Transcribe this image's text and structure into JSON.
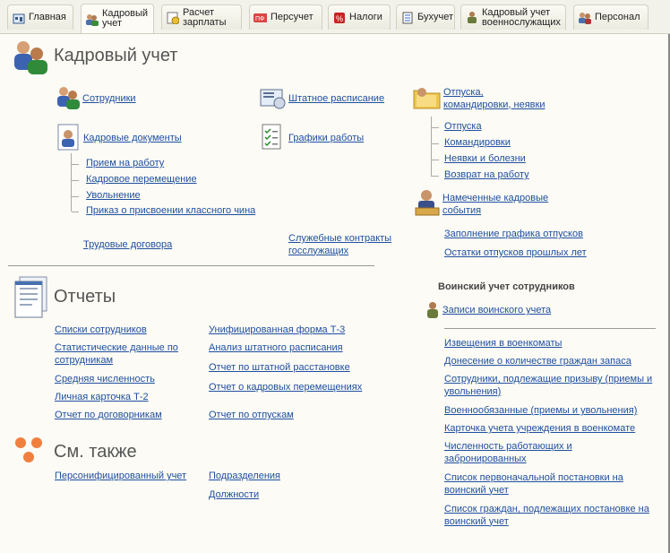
{
  "tabs": [
    {
      "label": "Главная",
      "icon": "home-icon"
    },
    {
      "label": "Кадровый\nучет",
      "icon": "people-icon"
    },
    {
      "label": "Расчет\nзарплаты",
      "icon": "payroll-icon"
    },
    {
      "label": "Персучет",
      "icon": "pfr-icon"
    },
    {
      "label": "Налоги",
      "icon": "taxes-icon"
    },
    {
      "label": "Бухучет",
      "icon": "accounting-icon"
    },
    {
      "label": "Кадровый учет\nвоеннослужащих",
      "icon": "military-icon"
    },
    {
      "label": "Персонал",
      "icon": "personnel-icon"
    }
  ],
  "hr_section": {
    "title": "Кадровый учет",
    "employees": "Сотрудники",
    "staff_schedule": "Штатное расписание",
    "leave_group": "Отпуска,\nкомандировки, неявки",
    "hr_docs": "Кадровые документы",
    "work_schedules": "Графики работы",
    "doc_items": [
      "Прием на работу",
      "Кадровое перемещение",
      "Увольнение",
      "Приказ о присвоении классного чина"
    ],
    "leave_items": [
      "Отпуска",
      "Командировки",
      "Неявки и болезни",
      "Возврат на работу"
    ],
    "planned_events": "Намеченные кадровые\nсобытия",
    "leave_plan": "Заполнение графика отпусков",
    "leave_balances": "Остатки отпусков прошлых лет",
    "labor_contracts": "Трудовые договора",
    "service_contracts": "Служебные контракты\nгосслужащих"
  },
  "reports": {
    "title": "Отчеты",
    "col1": [
      "Списки сотрудников",
      "Статистические данные по\nсотрудникам",
      "Средняя численность",
      "Личная карточка Т-2",
      "Отчет по договорникам"
    ],
    "col2": [
      "Унифицированная форма Т-3",
      "Анализ штатного расписания",
      "Отчет по штатной расстановке",
      "Отчет о кадровых перемещениях",
      "Отчет по отпускам"
    ]
  },
  "military": {
    "title": "Воинский учет сотрудников",
    "records": "Записи воинского учета",
    "items": [
      "Извещения в военкоматы",
      "Донесение о количестве граждан запаса",
      "Сотрудники, подлежащие призыву (приемы и\nувольнения)",
      "Военнообязанные (приемы и увольнения)",
      "Карточка учета учреждения в военкомате",
      "Численность работающих и\nзабронированных",
      "Список первоначальной постановки на\nвоинский учет",
      "Список граждан, подлежащих постановке на\nвоинский учет"
    ]
  },
  "see_also": {
    "title": "См. также",
    "personified": "Персонифицированный учет",
    "departments": "Подразделения",
    "positions": "Должности"
  }
}
